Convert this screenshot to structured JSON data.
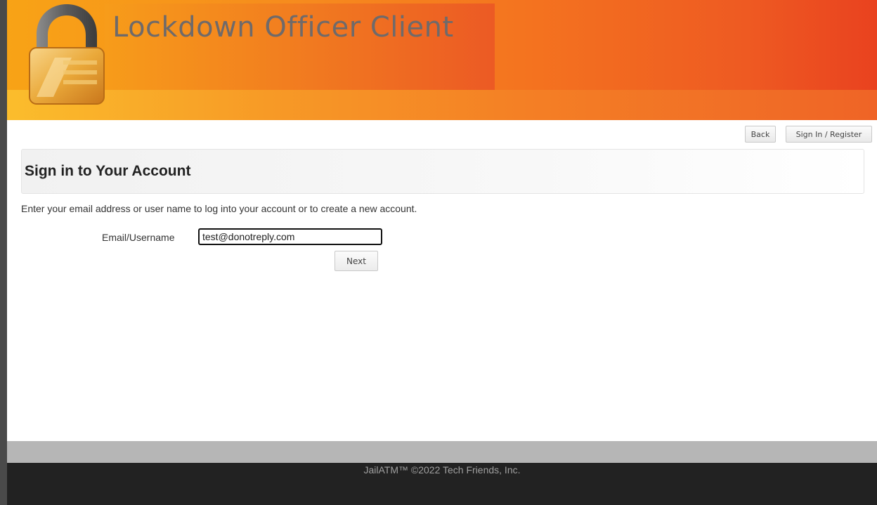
{
  "header": {
    "app_title": "Lockdown Officer Client",
    "logo_icon": "padlock-icon"
  },
  "nav": {
    "back_label": "Back",
    "signin_label": "Sign In / Register"
  },
  "main": {
    "heading": "Sign in to Your Account",
    "intro": "Enter your email address or user name to log into your account or to create a new account.",
    "email_label": "Email/Username",
    "email_value": "test@donotreply.com",
    "next_label": "Next"
  },
  "footer": {
    "copyright": "JailATM™ ©2022 Tech Friends, Inc."
  },
  "colors": {
    "banner_start": "#f8a316",
    "banner_end": "#e9421f",
    "title_text": "#6f6a6a",
    "footer_bg": "#222222"
  }
}
